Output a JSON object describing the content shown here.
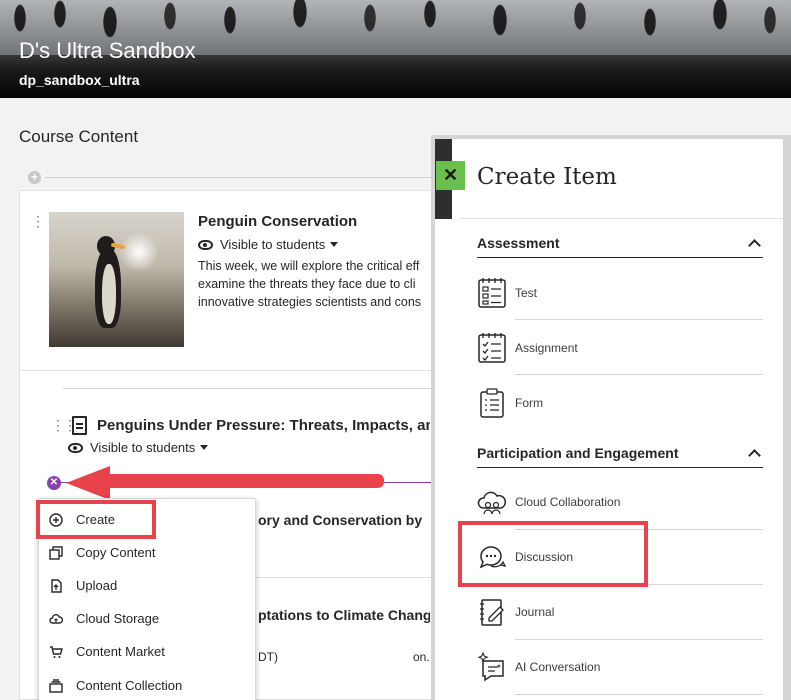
{
  "header": {
    "title": "D's Ultra Sandbox",
    "subtitle": "dp_sandbox_ultra"
  },
  "content": {
    "page_title": "Course Content",
    "items": [
      {
        "title": "Penguin Conservation",
        "visibility": "Visible to students",
        "description_lines": [
          "This week, we will explore the critical eff",
          "examine the threats they face due to cli",
          "innovative strategies scientists and cons"
        ]
      },
      {
        "title": "Penguins Under Pressure: Threats, Impacts, and",
        "visibility": "Visible to students"
      }
    ],
    "partial_items": [
      {
        "title": "ory and Conservation by"
      },
      {
        "title": "ptations to Climate Chang",
        "text": "DT)"
      }
    ],
    "partial_note": "on."
  },
  "add_menu": {
    "items": [
      {
        "label": "Create",
        "icon": "plus-circle-icon"
      },
      {
        "label": "Copy Content",
        "icon": "copy-icon"
      },
      {
        "label": "Upload",
        "icon": "upload-icon"
      },
      {
        "label": "Cloud Storage",
        "icon": "cloud-icon"
      },
      {
        "label": "Content Market",
        "icon": "cart-icon"
      },
      {
        "label": "Content Collection",
        "icon": "collection-icon"
      }
    ]
  },
  "create_panel": {
    "title": "Create Item",
    "close_label": "✕",
    "sections": [
      {
        "heading": "Assessment",
        "items": [
          {
            "label": "Test",
            "icon": "test-icon"
          },
          {
            "label": "Assignment",
            "icon": "assignment-icon"
          },
          {
            "label": "Form",
            "icon": "form-icon"
          }
        ]
      },
      {
        "heading": "Participation and Engagement",
        "items": [
          {
            "label": "Cloud Collaboration",
            "icon": "cloud-collaboration-icon"
          },
          {
            "label": "Discussion",
            "icon": "discussion-icon"
          },
          {
            "label": "Journal",
            "icon": "journal-icon"
          },
          {
            "label": "AI Conversation",
            "icon": "ai-conversation-icon"
          }
        ]
      }
    ]
  },
  "colors": {
    "highlight": "#e8434b",
    "accent_purple": "#8a3fb2",
    "close_green": "#6bbf4e"
  }
}
